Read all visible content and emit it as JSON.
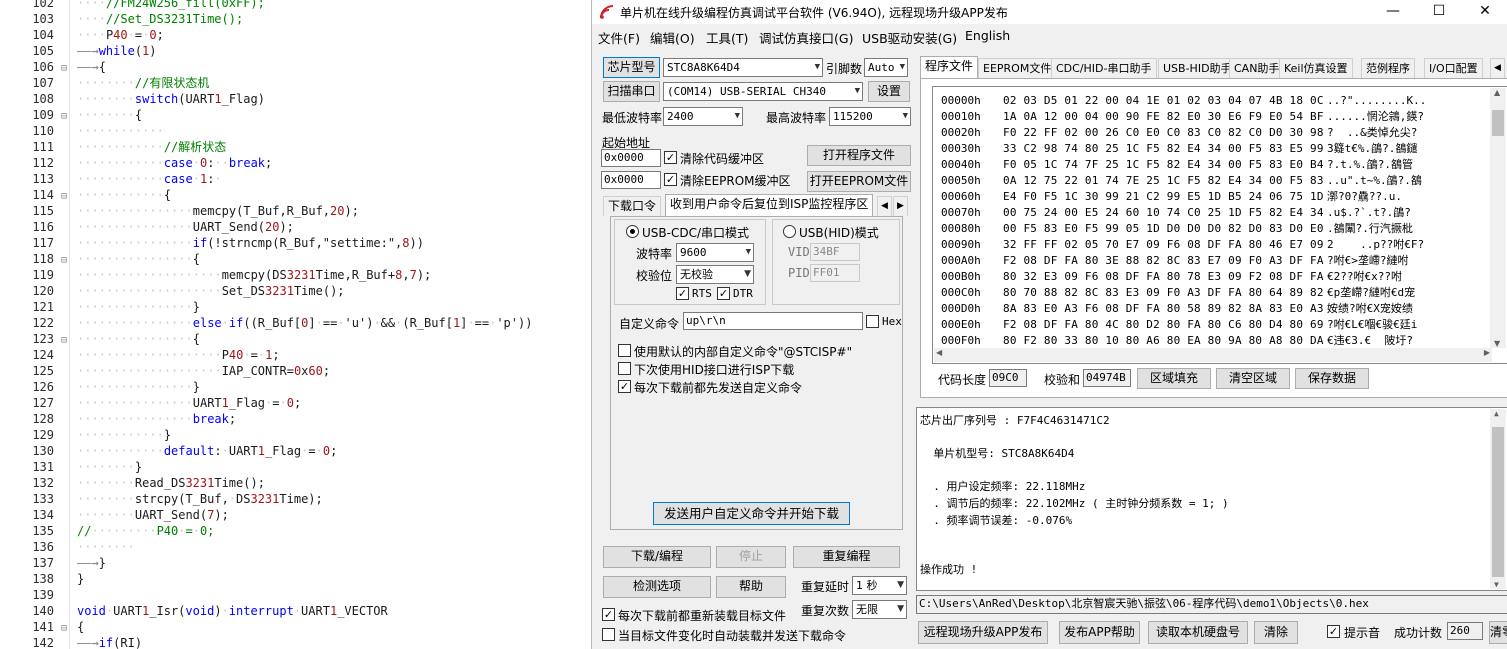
{
  "editor": {
    "lines": [
      {
        "n": "102",
        "fold": "",
        "text": "····//FM24W256_fill(0xFF);"
      },
      {
        "n": "103",
        "fold": "",
        "text": "····//Set_DS3231Time();"
      },
      {
        "n": "104",
        "fold": "",
        "text": "····P40·=·0;"
      },
      {
        "n": "105",
        "fold": "",
        "text": "——→while(1)"
      },
      {
        "n": "106",
        "fold": "⊟",
        "text": "——→{"
      },
      {
        "n": "107",
        "fold": "",
        "text": "········//有限状态机"
      },
      {
        "n": "108",
        "fold": "",
        "text": "········switch(UART1_Flag)"
      },
      {
        "n": "109",
        "fold": "⊟",
        "text": "········{"
      },
      {
        "n": "110",
        "fold": "",
        "text": "············"
      },
      {
        "n": "111",
        "fold": "",
        "text": "············//解析状态"
      },
      {
        "n": "112",
        "fold": "",
        "text": "············case·0:··break;"
      },
      {
        "n": "113",
        "fold": "",
        "text": "············case·1:·"
      },
      {
        "n": "114",
        "fold": "⊟",
        "text": "············{"
      },
      {
        "n": "115",
        "fold": "",
        "text": "················memcpy(T_Buf,R_Buf,20);"
      },
      {
        "n": "116",
        "fold": "",
        "text": "················UART_Send(20);"
      },
      {
        "n": "117",
        "fold": "",
        "text": "················if(!strncmp(R_Buf,\"settime:\",8))"
      },
      {
        "n": "118",
        "fold": "⊟",
        "text": "················{"
      },
      {
        "n": "119",
        "fold": "",
        "text": "····················memcpy(DS3231Time,R_Buf+8,7);"
      },
      {
        "n": "120",
        "fold": "",
        "text": "····················Set_DS3231Time();"
      },
      {
        "n": "121",
        "fold": "",
        "text": "················}"
      },
      {
        "n": "122",
        "fold": "",
        "text": "················else·if((R_Buf[0]·==·'u')·&&·(R_Buf[1]·==·'p'))"
      },
      {
        "n": "123",
        "fold": "⊟",
        "text": "················{"
      },
      {
        "n": "124",
        "fold": "",
        "text": "····················P40·=·1;"
      },
      {
        "n": "125",
        "fold": "",
        "text": "····················IAP_CONTR=0x60;"
      },
      {
        "n": "126",
        "fold": "",
        "text": "················}"
      },
      {
        "n": "127",
        "fold": "",
        "text": "················UART1_Flag·=·0;"
      },
      {
        "n": "128",
        "fold": "",
        "text": "················break;"
      },
      {
        "n": "129",
        "fold": "",
        "text": "············}"
      },
      {
        "n": "130",
        "fold": "",
        "text": "············default:·UART1_Flag·=·0;"
      },
      {
        "n": "131",
        "fold": "",
        "text": "········}"
      },
      {
        "n": "132",
        "fold": "",
        "text": "········Read_DS3231Time();"
      },
      {
        "n": "133",
        "fold": "",
        "text": "········strcpy(T_Buf,·DS3231Time);"
      },
      {
        "n": "134",
        "fold": "",
        "text": "········UART_Send(7);"
      },
      {
        "n": "135",
        "fold": "",
        "text": "//·········P40·=·0;"
      },
      {
        "n": "136",
        "fold": "",
        "text": "········"
      },
      {
        "n": "137",
        "fold": "",
        "text": "——→}"
      },
      {
        "n": "138",
        "fold": "",
        "text": "}"
      },
      {
        "n": "139",
        "fold": "",
        "text": ""
      },
      {
        "n": "140",
        "fold": "",
        "text": "void·UART1_Isr(void)·interrupt·UART1_VECTOR"
      },
      {
        "n": "141",
        "fold": "⊟",
        "text": "{"
      },
      {
        "n": "142",
        "fold": "",
        "text": "——→if(RI)"
      }
    ]
  },
  "window": {
    "title": "单片机在线升级编程仿真调试平台软件 (V6.94O), 远程现场升级APP发布",
    "minimize": "—",
    "maximize": "☐",
    "close": "✕"
  },
  "menu": [
    "文件(F)",
    "编辑(O)",
    "工具(T)",
    "调试仿真接口(G)",
    "USB驱动安装(G)",
    "English"
  ],
  "left": {
    "chip_type_btn": "芯片型号",
    "chip_type": "STC8A8K64D4",
    "pins_label": "引脚数",
    "pins": "Auto",
    "scan_port_btn": "扫描串口",
    "port": "(COM14) USB-SERIAL CH340",
    "settings_btn": "设置",
    "min_baud_label": "最低波特率",
    "min_baud": "2400",
    "max_baud_label": "最高波特率",
    "max_baud": "115200",
    "start_addr_label": "起始地址",
    "code_addr": "0x0000",
    "clear_code_label": "清除代码缓冲区",
    "open_prog_btn": "打开程序文件",
    "eeprom_addr": "0x0000",
    "clear_eeprom_label": "清除EEPROM缓冲区",
    "open_eeprom_btn": "打开EEPROM文件",
    "tabs": [
      "下载口令",
      "收到用户命令后复位到ISP监控程序区"
    ],
    "cdc_mode": "USB-CDC/串口模式",
    "hid_mode": "USB(HID)模式",
    "baud_label": "波特率",
    "baud": "9600",
    "parity_label": "校验位",
    "parity": "无校验",
    "rts": "RTS",
    "dtr": "DTR",
    "vid_label": "VID",
    "vid": "34BF",
    "pid_label": "PID",
    "pid": "FF01",
    "custom_cmd_label": "自定义命令",
    "custom_cmd": "up\\r\\n",
    "hex_label": "Hex",
    "opt1": "使用默认的内部自定义命令\"@STCISP#\"",
    "opt2": "下次使用HID接口进行ISP下载",
    "opt3": "每次下载前都先发送自定义命令",
    "send_btn": "发送用户自定义命令并开始下载",
    "download_btn": "下载/编程",
    "stop_btn": "停止",
    "reprogram_btn": "重复编程",
    "check_btn": "检测选项",
    "help_btn": "帮助",
    "repeat_delay_label": "重复延时",
    "repeat_delay": "1 秒",
    "repeat_count_label": "重复次数",
    "repeat_count": "无限",
    "reload_label": "每次下载前都重新装载目标文件",
    "auto_label": "当目标文件变化时自动装载并发送下载命令"
  },
  "right": {
    "tabs": [
      "程序文件",
      "EEPROM文件",
      "CDC/HID-串口助手",
      "USB-HID助手",
      "CAN助手",
      "Keil仿真设置",
      "范例程序",
      "I/O口配置"
    ],
    "hex_rows": [
      {
        "addr": "00000h",
        "bytes": "02 03 D5 01 22 00 04 1E 01 02 03 04 07 4B 18 0C",
        "ascii": "..?\"........K.."
      },
      {
        "addr": "00010h",
        "bytes": "1A 0A 12 00 04 00 90 FE 82 E0 30 E6 F9 E0 54 BF",
        "ascii": "......惘沦鶎‚鍈?"
      },
      {
        "addr": "00020h",
        "bytes": "F0 22 FF 02 00 26 C0 E0 C0 83 C0 82 C0 D0 30 98",
        "ascii": "?  ..&类悼允尖?"
      },
      {
        "addr": "00030h",
        "bytes": "33 C2 98 74 80 25 1C F5 82 E4 34 00 F5 83 E5 99",
        "ascii": "3籎t€%.鵮?.鵅鑓"
      },
      {
        "addr": "00040h",
        "bytes": "F0 05 1C 74 7F 25 1C F5 82 E4 34 00 F5 83 E0 B4",
        "ascii": "?.t.%.鵮?.鵅管"
      },
      {
        "addr": "00050h",
        "bytes": "0A 12 75 22 01 74 7E 25 1C F5 82 E4 34 00 F5 83",
        "ascii": "..u\".t~%.鵮?.鵅"
      },
      {
        "addr": "00060h",
        "bytes": "E4 F0 F5 1C 30 99 21 C2 99 E5 1D B5 24 06 75 1D",
        "ascii": "漷?0?驫??.u."
      },
      {
        "addr": "00070h",
        "bytes": "00 75 24 00 E5 24 60 10 74 C0 25 1D F5 82 E4 34",
        "ascii": ".u$.?`.t?.鵮?"
      },
      {
        "addr": "00080h",
        "bytes": "00 F5 83 E0 F5 99 05 1D D0 D0 D0 82 D0 83 D0 E0",
        "ascii": ".鵅闈?.行汽撅枇"
      },
      {
        "addr": "00090h",
        "bytes": "32 FF FF 02 05 70 E7 09 F6 08 DF FA 80 46 E7 09",
        "ascii": "2    ..p??咐€F?"
      },
      {
        "addr": "000A0h",
        "bytes": "F2 08 DF FA 80 3E 88 82 8C 83 E7 09 F0 A3 DF FA",
        "ascii": "?咐€>垄嵽?縺咐"
      },
      {
        "addr": "000B0h",
        "bytes": "80 32 E3 09 F6 08 DF FA 80 78 E3 09 F2 08 DF FA",
        "ascii": "€2??咐€x??咐"
      },
      {
        "addr": "000C0h",
        "bytes": "80 70 88 82 8C 83 E3 09 F0 A3 DF FA 80 64 89 82",
        "ascii": "€p垄嵽?縺咐€d宠"
      },
      {
        "addr": "000D0h",
        "bytes": "8A 83 E0 A3 F6 08 DF FA 80 58 89 82 8A 83 E0 A3",
        "ascii": "姲绩?咐€X宠姲绩"
      },
      {
        "addr": "000E0h",
        "bytes": "F2 08 DF FA 80 4C 80 D2 80 FA 80 C6 80 D4 80 69",
        "ascii": "?咐€L€嗰€骏€廷i"
      },
      {
        "addr": "000F0h",
        "bytes": "80 F2 80 33 80 10 80 A6 80 EA 80 9A 80 A8 80 DA",
        "ascii": "€违€3.€  陂圩?"
      }
    ],
    "code_len_label": "代码长度",
    "code_len": "09C0",
    "checksum_label": "校验和",
    "checksum": "04974B",
    "fill_btn": "区域填充",
    "clear_btn": "清空区域",
    "save_btn": "保存数据",
    "log": [
      "芯片出厂序列号 : F7F4C4631471C2",
      "",
      "  单片机型号: STC8A8K64D4",
      "",
      "  . 用户设定频率: 22.118MHz",
      "  . 调节后的频率: 22.102MHz ( 主时钟分频系数 = 1; )",
      "  . 频率调节误差: -0.076%",
      "",
      "",
      "操作成功 !"
    ],
    "path": "C:\\Users\\AnRed\\Desktop\\北京智宸天驰\\振弦\\06-程序代码\\demo1\\Objects\\0.hex",
    "remote_btn": "远程现场升级APP发布",
    "publish_help_btn": "发布APP帮助",
    "read_disk_btn": "读取本机硬盘号",
    "clear_log_btn": "清除",
    "sound_label": "提示音",
    "success_label": "成功计数",
    "success_count": "260",
    "clear_count_btn": "清零"
  }
}
